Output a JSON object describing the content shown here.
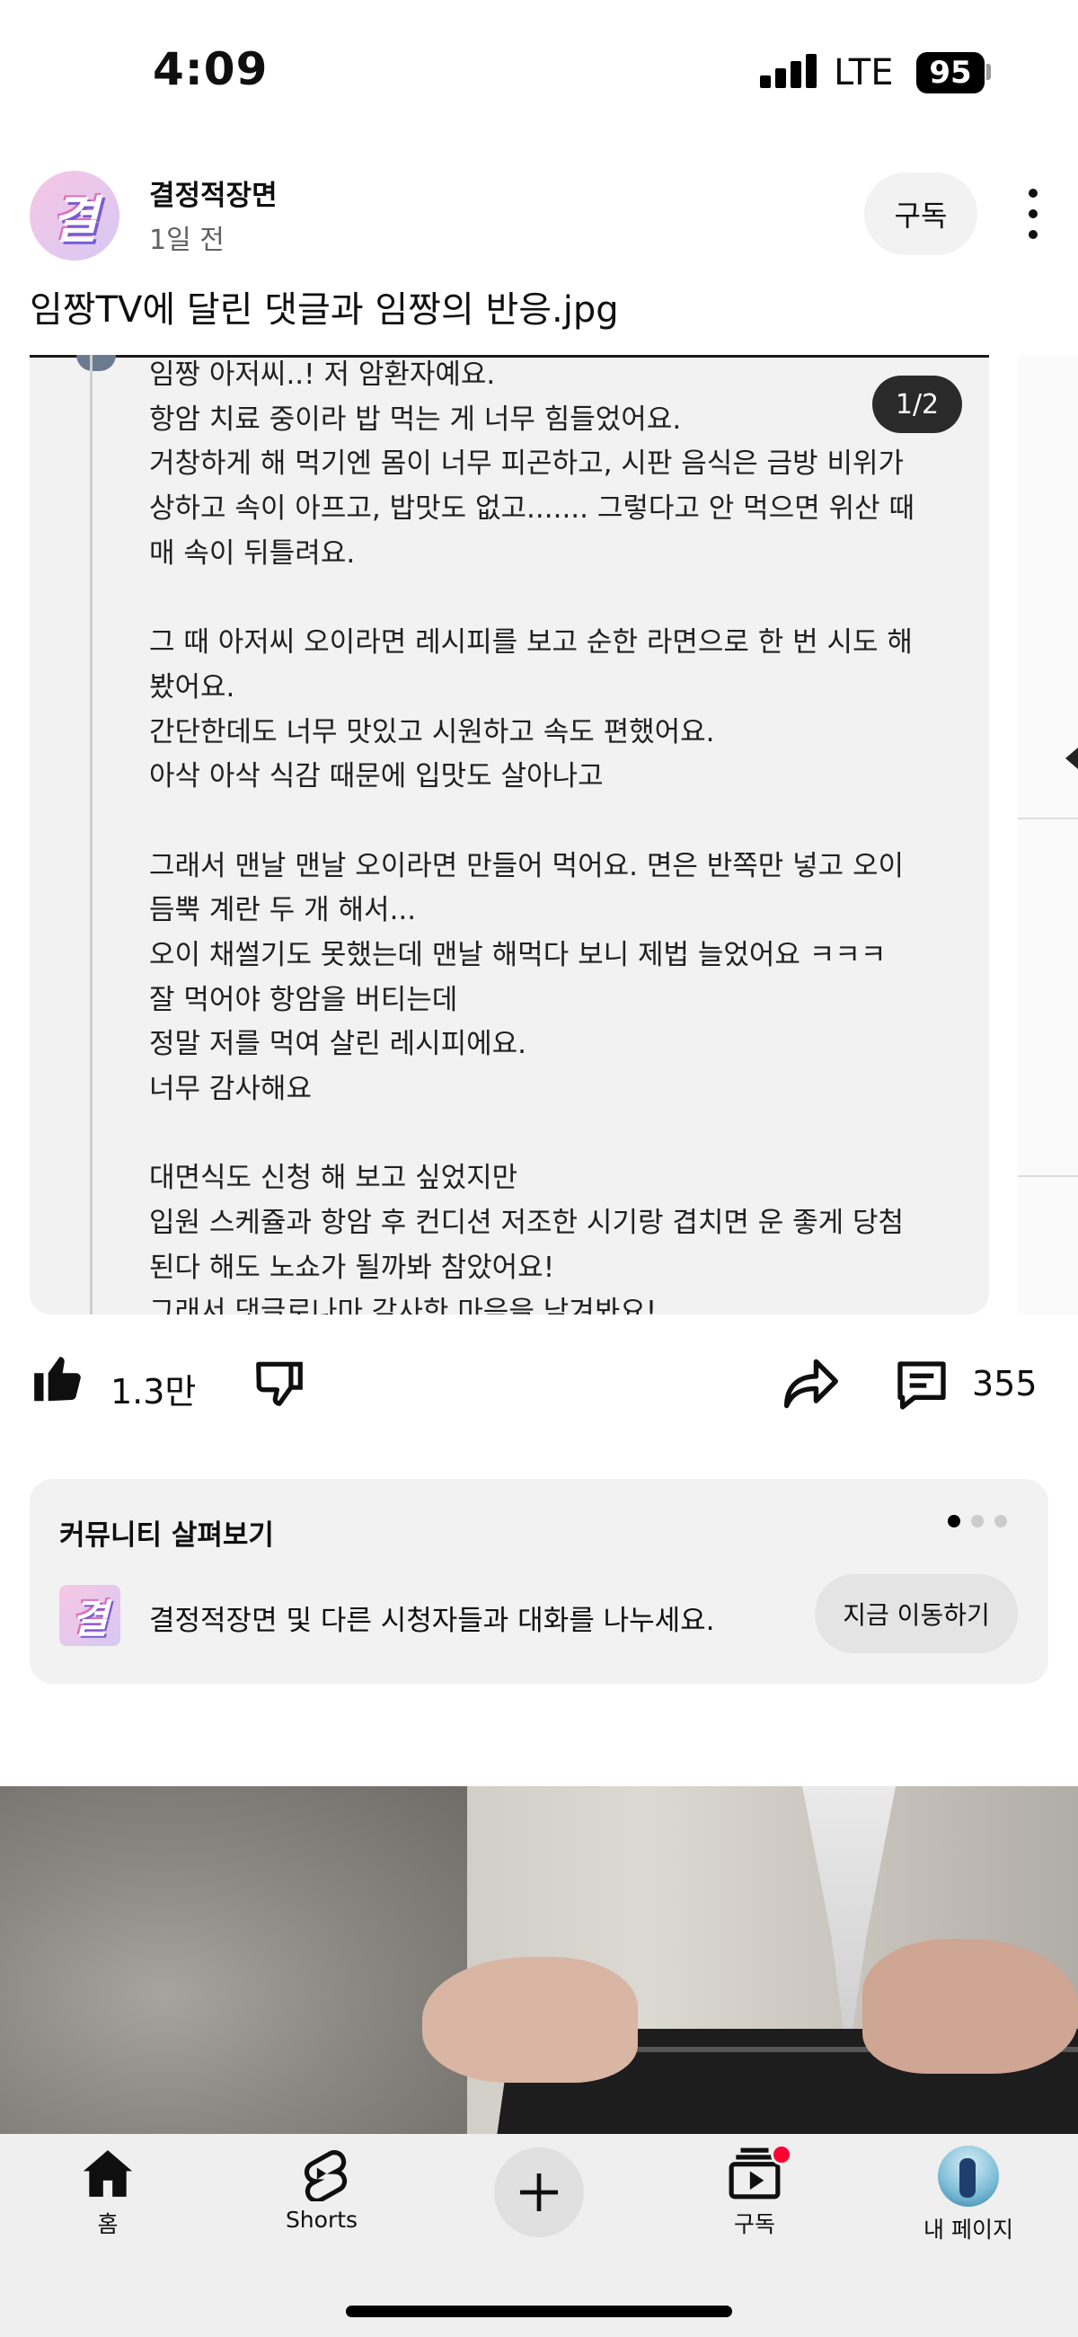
{
  "status_bar": {
    "time": "4:09",
    "network": "LTE",
    "battery": "95"
  },
  "post": {
    "channel_name": "결정적장면",
    "avatar_glyph": "결",
    "time_ago": "1일 전",
    "subscribe_label": "구독",
    "title": "임짱TV에 달린 댓글과 임짱의 반응.jpg",
    "page_indicator": "1/2",
    "comment_lines": [
      "임짱 아저씨..! 저 암환자예요.",
      "항암 치료 중이라 밥 먹는 게 너무 힘들었어요.",
      "거창하게 해 먹기엔 몸이 너무 피곤하고, 시판 음식은 금방 비위가",
      "상하고 속이 아프고, 밥맛도 없고....... 그렇다고 안 먹으면 위산 때",
      "매 속이 뒤틀려요.",
      "",
      "그 때 아저씨 오이라면 레시피를 보고 순한 라면으로 한 번 시도 해",
      "봤어요.",
      "간단한데도 너무 맛있고 시원하고 속도 편했어요.",
      "아삭 아삭 식감 때문에 입맛도 살아나고",
      "",
      "그래서 맨날 맨날 오이라면 만들어 먹어요. 면은 반쪽만 넣고 오이",
      "듬뿍 계란 두 개 해서...",
      "오이 채썰기도 못했는데 맨날 해먹다 보니 제법 늘었어요 ㅋㅋㅋ",
      "잘 먹어야 항암을 버티는데",
      "정말 저를 먹여 살린 레시피에요.",
      "너무 감사해요",
      "",
      "대면식도 신청 해 보고 싶었지만",
      "입원 스케쥴과 항암 후 컨디션 저조한 시기랑 겹치면 운 좋게 당첨",
      "된다 해도 노쇼가 될까봐 참았어요!",
      "그래서 댓글로나마 감사한 마음을 남겨봐요!"
    ]
  },
  "actions": {
    "like_count": "1.3만",
    "comment_count": "355"
  },
  "community": {
    "title": "커뮤니티 살펴보기",
    "description": "결정적장면 및 다른 시청자들과 대화를 나누세요.",
    "button_label": "지금 이동하기"
  },
  "bottom_nav": {
    "home": "홈",
    "shorts": "Shorts",
    "subscriptions": "구독",
    "profile": "내 페이지"
  },
  "colors": {
    "accent_red": "#ff0033",
    "card_bg": "#f2f2f2"
  }
}
